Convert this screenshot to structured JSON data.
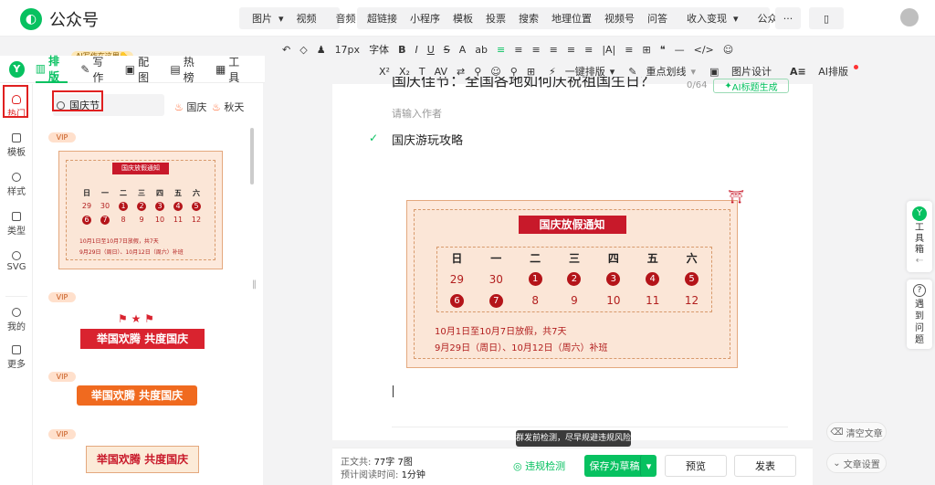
{
  "app": {
    "name": "公众号",
    "logo_letter": "Y"
  },
  "top_nav": {
    "group1": [
      "图片",
      "视频",
      "音频"
    ],
    "group2": [
      "超链接",
      "小程序",
      "模板",
      "投票",
      "搜索",
      "地理位置",
      "视频号",
      "问答",
      "收入变现",
      "公众号"
    ],
    "more": "···"
  },
  "ai_badge": "AI写作在这里👇",
  "editor_tabs": [
    {
      "label": "排版",
      "icon": "layout-icon",
      "active": true
    },
    {
      "label": "写作",
      "icon": "pen-icon",
      "active": false
    },
    {
      "label": "配图",
      "icon": "image-icon",
      "active": false
    },
    {
      "label": "热榜",
      "icon": "hot-icon",
      "active": false
    },
    {
      "label": "工具",
      "icon": "toolbox-icon",
      "active": false
    }
  ],
  "toolbar": {
    "row1": [
      "↶",
      "◇",
      "♟",
      "17px",
      "字体",
      "B",
      "I",
      "U",
      "S",
      "A",
      "ab",
      "≡",
      "≡",
      "≡",
      "≡",
      "≡",
      "≡",
      "|A|",
      "≡",
      "⊞",
      "❝",
      "—",
      "</>",
      "☺"
    ],
    "row2": [
      "X²",
      "X₂",
      "T",
      "AV",
      "⇄",
      "⚲",
      "☺",
      "⚲",
      "⊞"
    ],
    "one_click": "一键排版",
    "highlight": "重点划线",
    "image_design": "图片设计",
    "ai_layout": "AI排版"
  },
  "sidenav": [
    {
      "label": "热门",
      "icon": "fire-icon",
      "active": true
    },
    {
      "label": "模板",
      "icon": "template-icon"
    },
    {
      "label": "样式",
      "icon": "style-icon"
    },
    {
      "label": "类型",
      "icon": "type-icon"
    },
    {
      "label": "SVG",
      "icon": "svg-icon"
    },
    {
      "label": "我的",
      "icon": "user-icon"
    },
    {
      "label": "更多",
      "icon": "grid-icon"
    }
  ],
  "search": {
    "value": "国庆节",
    "hot_tags": [
      "国庆",
      "秋天"
    ]
  },
  "templates": {
    "vip": "VIP",
    "calendar_banner": "国庆放假通知",
    "weekdays": [
      "日",
      "一",
      "二",
      "三",
      "四",
      "五",
      "六"
    ],
    "week1": [
      "29",
      "30",
      "1",
      "2",
      "3",
      "4",
      "5"
    ],
    "week2": [
      "6",
      "7",
      "8",
      "9",
      "10",
      "11",
      "12"
    ],
    "note1": "10月1日至10月7日放假，共7天",
    "note2": "9月29日（周日）、10月12日（周六）补班",
    "ribbon1": "举国欢腾 共度国庆",
    "ribbon2": "举国欢腾 共度国庆",
    "ribbon3": "举国欢腾 共度国庆"
  },
  "article": {
    "title": "国庆佳节：全国各地如何庆祝祖国生日？",
    "word_count": "0/64",
    "ai_title": "AI标题生成",
    "author_placeholder": "请输入作者",
    "paragraph": "国庆游玩攻略"
  },
  "bottom": {
    "chars_label": "正文共:",
    "chars_value": "77字 7图",
    "read_label": "预计阅读时间:",
    "read_value": "1分钟",
    "tooltip": "群发前检测，尽早规避违规风险",
    "check": "违规检测",
    "save": "保存为草稿",
    "preview": "预览",
    "publish": "发表"
  },
  "right_tools": {
    "toolbox": "工具箱",
    "feedback": "遇到问题",
    "clear": "清空文章",
    "settings": "文章设置"
  }
}
